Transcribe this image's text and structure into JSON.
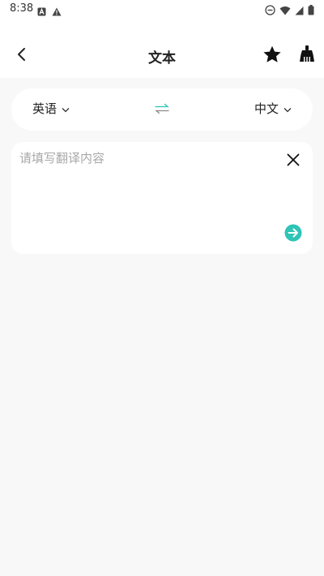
{
  "status_bar": {
    "time": "8:38",
    "icons": [
      "app-a-icon",
      "warning-icon",
      "do-not-disturb-icon",
      "wifi-icon",
      "signal-icon",
      "battery-icon"
    ]
  },
  "header": {
    "title": "文本",
    "back_icon": "chevron-left-icon",
    "favorite_icon": "star-icon",
    "clean_icon": "broom-icon"
  },
  "language_bar": {
    "source": "英语",
    "target": "中文",
    "swap_icon": "swap-arrows-icon"
  },
  "input": {
    "value": "",
    "placeholder": "请填写翻译内容"
  },
  "colors": {
    "accent": "#2ec4b6",
    "background": "#f8f8f8",
    "card": "#ffffff",
    "text": "#222222",
    "placeholder": "#a8a8a8"
  }
}
